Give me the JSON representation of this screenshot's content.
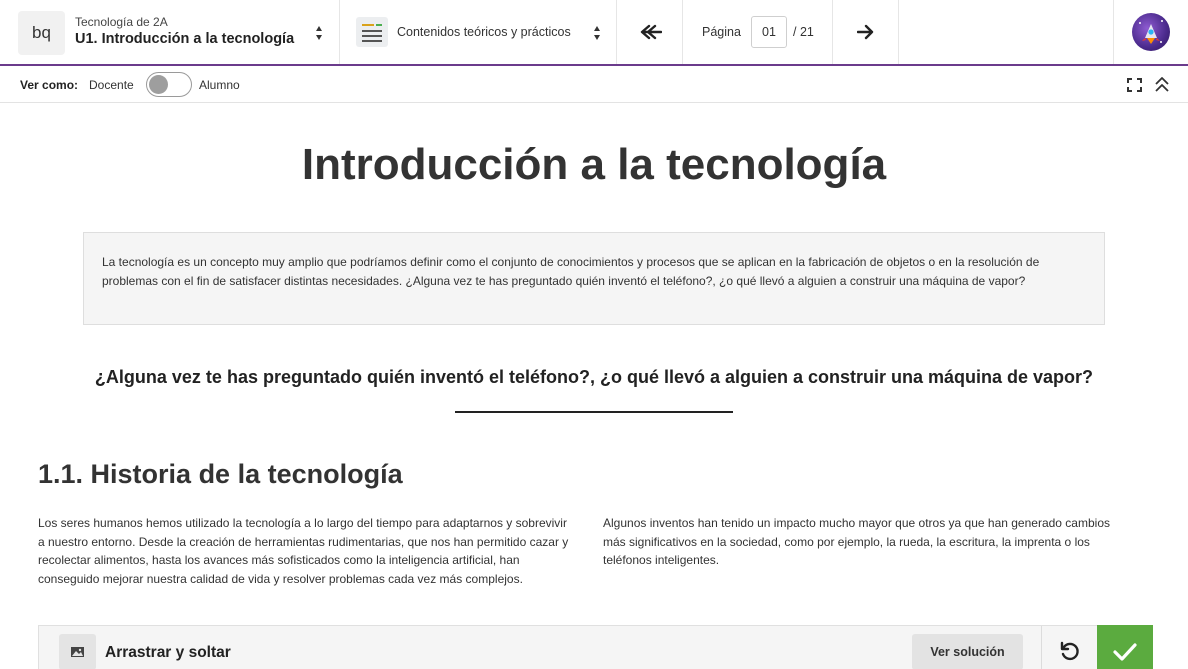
{
  "topbar": {
    "logo": "bq",
    "book_subtitle": "Tecnología de 2A",
    "book_title": "U1. Introducción a la tecnología",
    "content_selector": "Contenidos teóricos y prácticos",
    "page_label": "Página",
    "page_value": "01",
    "page_total": "/ 21",
    "icons": {
      "book_selector": "chevron-updown-icon",
      "content": "document-list-icon",
      "first_page": "double-arrow-left-icon",
      "next_page": "arrow-right-icon",
      "avatar": "rocket-avatar"
    }
  },
  "view_bar": {
    "label": "Ver como:",
    "option_teacher": "Docente",
    "option_student": "Alumno",
    "toggle_state": "docente",
    "icons": {
      "fullscreen": "fullscreen-icon",
      "collapse": "double-chevron-up-icon"
    }
  },
  "main": {
    "title": "Introducción a la tecnología",
    "intro": "La tecnología es un concepto muy amplio que podríamos definir como el conjunto de conocimientos y procesos que se aplican en la fabricación de objetos o en la resolución de problemas con el fin de satisfacer distintas necesidades. ¿Alguna vez te has preguntado quién inventó el teléfono?, ¿o qué llevó a alguien a construir una máquina de vapor?",
    "question": "¿Alguna vez te has preguntado quién inventó el teléfono?, ¿o qué llevó a alguien a construir una máquina de vapor?",
    "section_title": "1.1. Historia de la tecnología",
    "col_left": "Los seres humanos hemos utilizado la tecnología a lo largo del tiempo para adaptarnos y sobrevivir a nuestro entorno. Desde la creación de herramientas rudimentarias, que nos han permitido cazar y recolectar alimentos, hasta los avances más sofisticados como la inteligencia artificial, han conseguido mejorar nuestra calidad de vida y resolver problemas cada vez más complejos.",
    "col_right": "Algunos inventos han tenido un impacto mucho mayor que otros ya que han generado cambios más significativos en la sociedad, como por ejemplo, la rueda, la escritura, la imprenta o los teléfonos inteligentes."
  },
  "activity": {
    "title": "Arrastrar y soltar",
    "solution_label": "Ver solución",
    "icons": {
      "type": "image-icon",
      "reset": "reset-icon",
      "check": "check-icon"
    },
    "check_color": "#5bab3f"
  },
  "colors": {
    "accent": "#6b3b8c",
    "text": "#333333",
    "panel": "#f5f5f5"
  }
}
